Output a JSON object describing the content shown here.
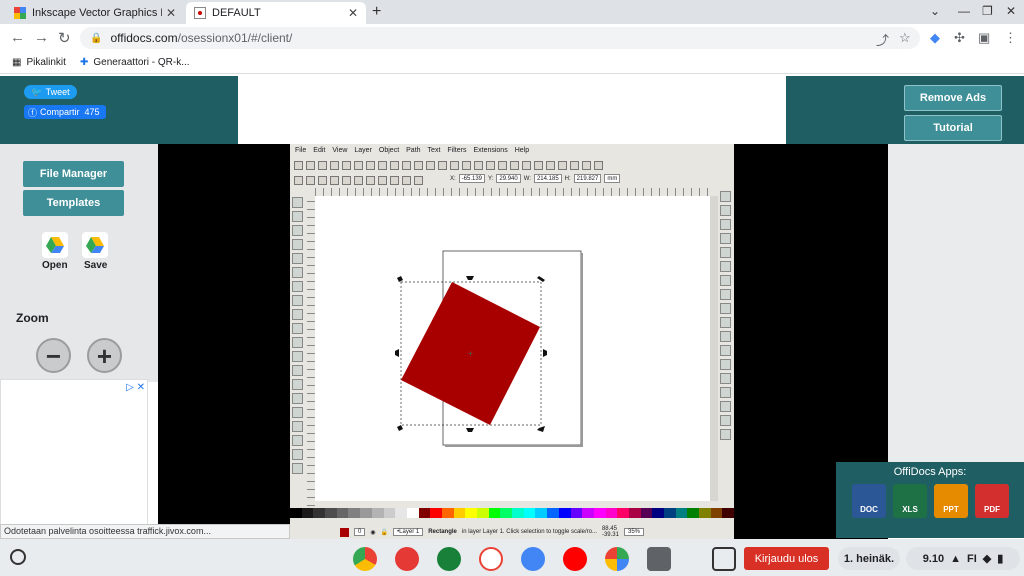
{
  "browser": {
    "tabs": [
      {
        "title": "Inkscape Vector Graphics Editor",
        "active": false
      },
      {
        "title": "DEFAULT",
        "active": true
      }
    ],
    "url_host": "offidocs.com",
    "url_path": "/osessionx01/#/client/",
    "bookmarks": [
      "Pikalinkit",
      "Generaattori - QR-k..."
    ]
  },
  "social": {
    "tweet": "Tweet",
    "share": "Compartir",
    "share_count": "475"
  },
  "buttons": {
    "remove_ads": "Remove Ads",
    "tutorial": "Tutorial",
    "file_manager": "File Manager",
    "templates": "Templates",
    "open": "Open",
    "save": "Save",
    "zoom": "Zoom",
    "zoom_out": "−",
    "zoom_in": "+"
  },
  "inkscape": {
    "menu": [
      "File",
      "Edit",
      "View",
      "Layer",
      "Object",
      "Path",
      "Text",
      "Filters",
      "Extensions",
      "Help"
    ],
    "coords": {
      "x_label": "X:",
      "x": "-65.139",
      "y_label": "Y:",
      "y": "29.940",
      "w_label": "W:",
      "w": "214.185",
      "h_label": "H:",
      "h": "219.827",
      "unit": "mm"
    },
    "status": {
      "layer": "•Layer 1",
      "object": "Rectangle",
      "message": "in layer Layer 1. Click selection to toggle scale/ro...",
      "cursor_x": "88.45",
      "cursor_y": "-39.31",
      "zoom": "35%",
      "opacity": "0"
    },
    "shape_color": "#a80000",
    "palette": [
      "#000000",
      "#1a1a1a",
      "#333333",
      "#4d4d4d",
      "#666666",
      "#808080",
      "#999999",
      "#b3b3b3",
      "#cccccc",
      "#e6e6e6",
      "#ffffff",
      "#800000",
      "#ff0000",
      "#ff6600",
      "#ffcc00",
      "#ffff00",
      "#ccff00",
      "#00ff00",
      "#00ff66",
      "#00ffcc",
      "#00ffff",
      "#00ccff",
      "#0066ff",
      "#0000ff",
      "#6600ff",
      "#cc00ff",
      "#ff00ff",
      "#ff00cc",
      "#ff0066",
      "#aa0044",
      "#550055",
      "#000080",
      "#004080",
      "#008080",
      "#008000",
      "#808000",
      "#804000",
      "#400000"
    ]
  },
  "offidocs_apps": {
    "title": "OffiDocs Apps:",
    "apps": [
      "DOC",
      "XLS",
      "PPT",
      "PDF"
    ]
  },
  "status_message": "Odotetaan palvelinta osoitteessa traffick.jivox.com...",
  "taskbar": {
    "signout": "Kirjaudu ulos",
    "date": "1. heinäk.",
    "time": "9.10",
    "lang": "FI"
  }
}
